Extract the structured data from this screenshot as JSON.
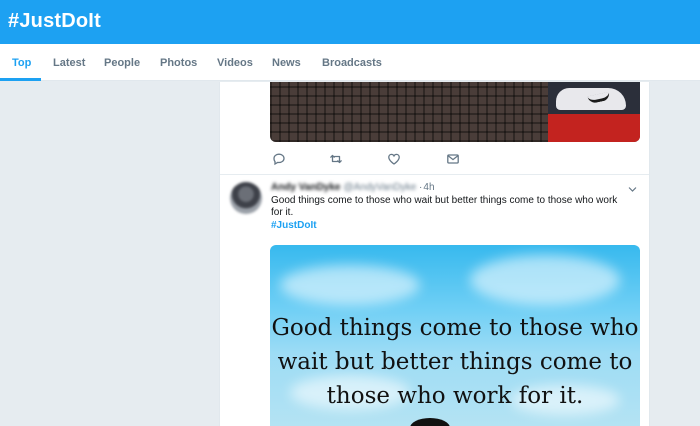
{
  "header": {
    "title": "#JustDoIt"
  },
  "tabs": [
    {
      "label": "Top",
      "active": true
    },
    {
      "label": "Latest"
    },
    {
      "label": "People"
    },
    {
      "label": "Photos"
    },
    {
      "label": "Videos"
    },
    {
      "label": "News"
    },
    {
      "label": "Broadcasts"
    }
  ],
  "actions": [
    {
      "name": "reply-icon"
    },
    {
      "name": "retweet-icon"
    },
    {
      "name": "like-icon"
    },
    {
      "name": "message-icon"
    }
  ],
  "tweet": {
    "author": "Andy VanDyke",
    "handle": "@AndyVanDyke",
    "separator": "·",
    "time": "4h",
    "text": "Good things come to those who wait but better things come to those who work for it.",
    "hashtag": "#JustDoIt",
    "image_quote": [
      "Good things come to those who",
      "wait but better things come to",
      "those who work for it."
    ]
  },
  "colors": {
    "accent": "#1da1f2",
    "background": "#e6ecf0",
    "icon": "#657786"
  }
}
